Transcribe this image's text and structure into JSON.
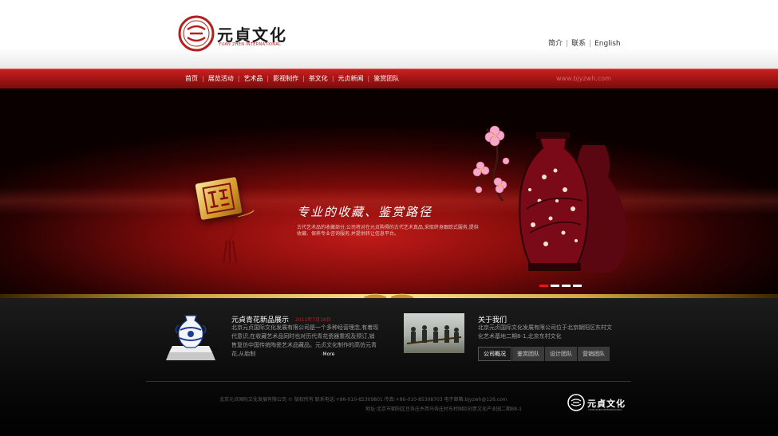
{
  "brand": {
    "name_cn": "元貞文化",
    "name_en": "YUAN ZHEN INTERNATIONAL",
    "colors": {
      "primary": "#b0211f",
      "gold": "#d6a73f",
      "dark": "#000000"
    }
  },
  "top_links": [
    "简介",
    "联系",
    "English"
  ],
  "nav": {
    "items": [
      "首页",
      "展览活动",
      "艺术品",
      "影视制作",
      "茶文化",
      "元贞新闻",
      "鉴赏团队"
    ],
    "site_url": "www.bjyzwh.com"
  },
  "banner": {
    "slogan": "专业的收藏、鉴赏路径",
    "description": "古代艺术品的收藏部分,公司将对在元贞购得的古代艺术真品,采取终身跟踪式服务,提供收藏、保养专业咨询服务,并提供转让信息平台。",
    "slide_count": 4,
    "active_slide": 1
  },
  "product": {
    "title": "元貞青花新品展示",
    "date": "2011年7月18日",
    "description": "北京元贞国际文化发展有限公司是一个多种经营理念,有着现代意识,在收藏艺术品同时也对历代青花瓷器重视及预订,销售复仿中国传统陶瓷艺术品藏品。元贞文化制作的高仿元青花,从胎制",
    "more_label": "More"
  },
  "about": {
    "title": "关于我们",
    "description": "北京元贞国际文化发展有限公司位于北京朝阳区东村文化艺术基地二期8-1,北京东村文化",
    "tabs": [
      "公司概况",
      "鉴赏团队",
      "设计团队",
      "营销团队"
    ],
    "active_tab": 0
  },
  "footer": {
    "line1": "北京元贞国际文化发展有限公司 © 版权所有 联系电话:+86-010-85309801 传真:+86-010-85308703 电子邮箱:bjyzwh@126.com",
    "line2": "地址:北京市朝阳区豆各庄乡西马各庄村东村国际创意文化产业园二期B8-1",
    "logo_cn": "元貞文化",
    "logo_en": "YUAN ZHEN INTERNATIONAL"
  },
  "icons": [
    "seal-logo-icon",
    "gold-seal-icon",
    "tassel-icon",
    "vase-image",
    "plum-blossom-icon",
    "porcelain-jar-image",
    "people-photo-image"
  ]
}
